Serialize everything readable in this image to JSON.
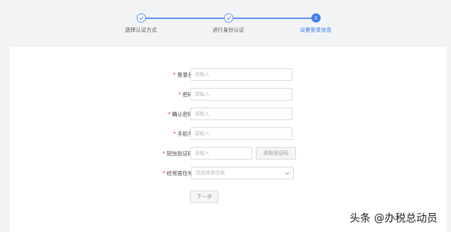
{
  "steps": [
    {
      "label": "选择认证方式",
      "state": "done"
    },
    {
      "label": "进行身份认证",
      "state": "done"
    },
    {
      "label": "设置登录信息",
      "state": "active",
      "number": "3"
    }
  ],
  "form": {
    "fields": [
      {
        "label": "登录名",
        "required": true,
        "placeholder": "请输入"
      },
      {
        "label": "密码",
        "required": true,
        "placeholder": "请输入"
      },
      {
        "label": "确认密码",
        "required": true,
        "placeholder": "请输入"
      },
      {
        "label": "手机号",
        "required": true,
        "placeholder": "请输入"
      },
      {
        "label": "短信验证码",
        "required": true,
        "placeholder": "请输入"
      },
      {
        "label": "经常居住地",
        "required": true,
        "placeholder": "请选择居住地"
      }
    ],
    "required_mark": "*",
    "sms_button": "获取验证码",
    "next_button": "下一步"
  },
  "watermark": "头条 @办税总动员",
  "colors": {
    "accent": "#3f7ef2",
    "required": "#e64545"
  }
}
